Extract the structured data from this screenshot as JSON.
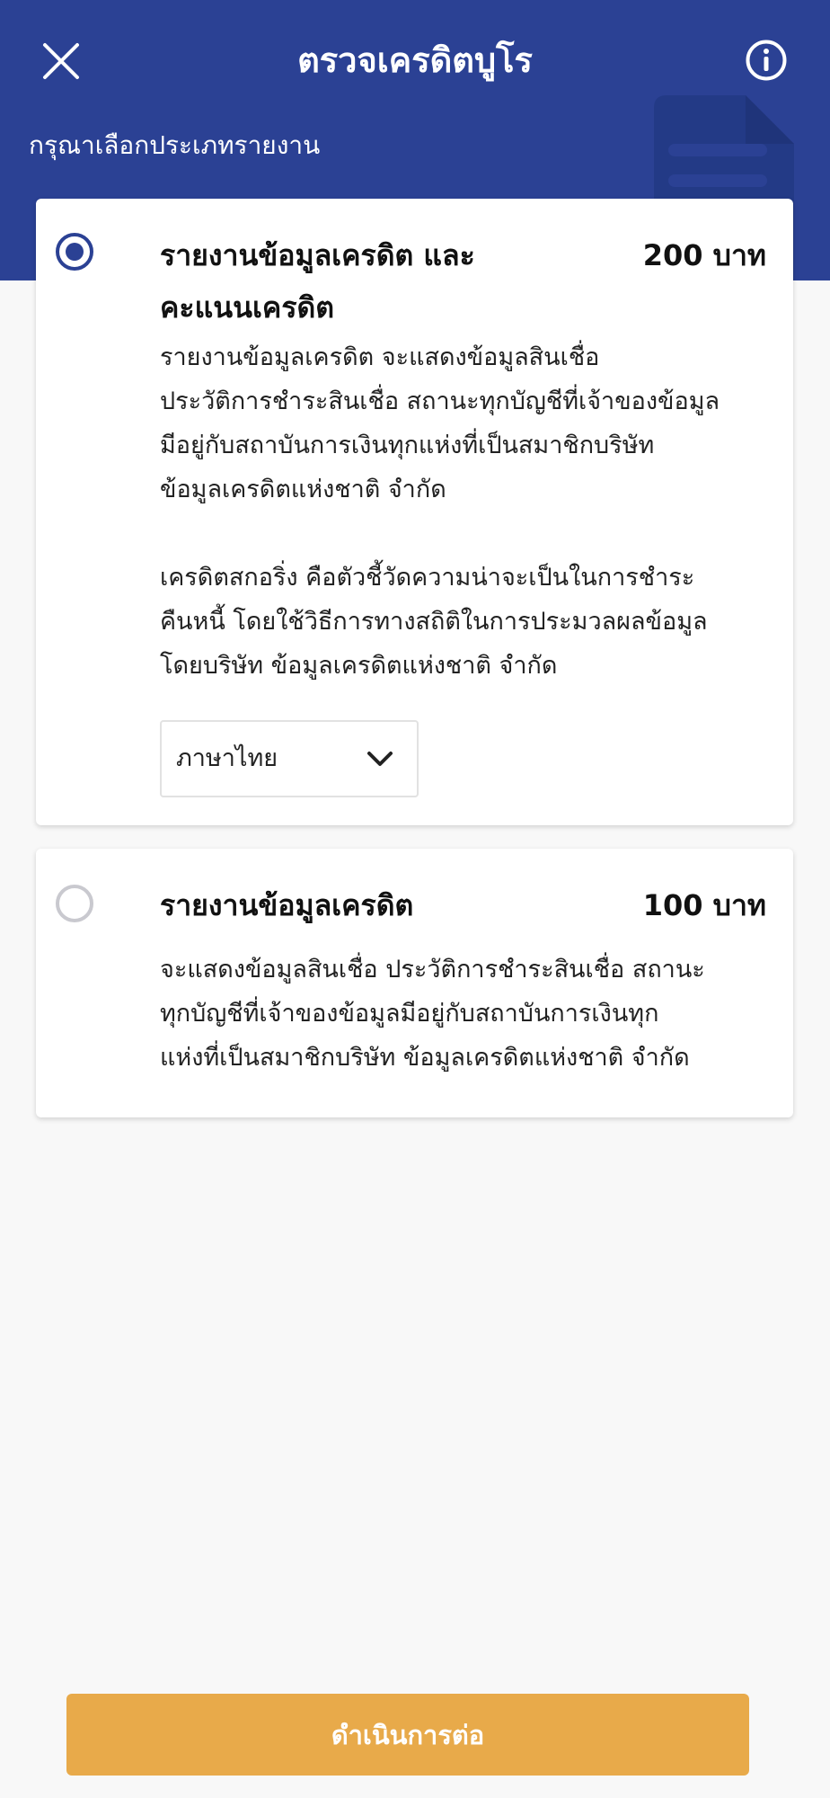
{
  "header": {
    "title": "ตรวจเครดิตบูโร",
    "subtitle": "กรุณาเลือกประเภทรายงาน",
    "close_icon": "close-icon",
    "info_icon": "info-icon",
    "background_color": "#2b4194"
  },
  "options": [
    {
      "selected": true,
      "title_lines": [
        "รายงานข้อมูลเครดิต และ",
        "คะแนนเครดิต"
      ],
      "price": "200 บาท",
      "description_lines": [
        "รายงานข้อมูลเครดิต จะแสดงข้อมูลสินเชื่อ",
        "ประวัติการชำระสินเชื่อ สถานะทุกบัญชีที่เจ้าของข้อมูล",
        "มีอยู่กับสถาบันการเงินทุกแห่งที่เป็นสมาชิกบริษัท",
        "ข้อมูลเครดิตแห่งชาติ จำกัด",
        "",
        "เครดิตสกอริ่ง คือตัวชี้วัดความน่าจะเป็นในการชำระ",
        "คืนหนี้ โดยใช้วิธีการทางสถิติในการประมวลผลข้อมูล",
        "โดยบริษัท ข้อมูลเครดิตแห่งชาติ จำกัด"
      ],
      "language_select": {
        "value": "ภาษาไทย",
        "icon": "chevron-down-icon"
      }
    },
    {
      "selected": false,
      "title": "รายงานข้อมูลเครดิต",
      "price": "100 บาท",
      "description_lines": [
        "จะแสดงข้อมูลสินเชื่อ ประวัติการชำระสินเชื่อ สถานะ",
        "ทุกบัญชีที่เจ้าของข้อมูลมีอยู่กับสถาบันการเงินทุก",
        "แห่งที่เป็นสมาชิกบริษัท ข้อมูลเครดิตแห่งชาติ จำกัด"
      ]
    }
  ],
  "footer": {
    "continue_label": "ดำเนินการต่อ",
    "button_color": "#e8aa4a"
  }
}
